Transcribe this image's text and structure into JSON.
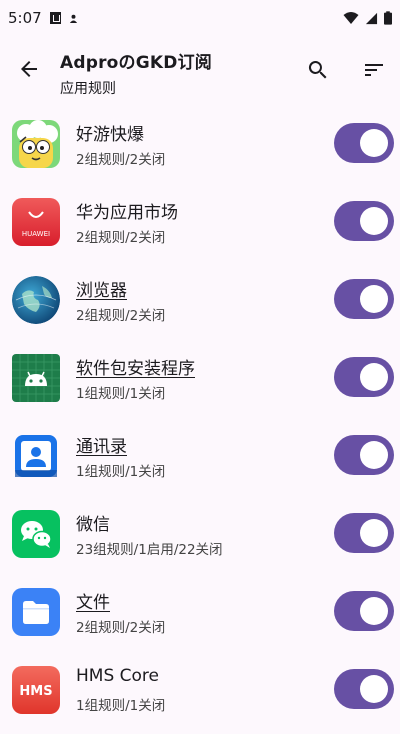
{
  "status_bar": {
    "time": "5:07"
  },
  "header": {
    "title": "AdproのGKD订阅",
    "subtitle": "应用规则"
  },
  "icons": {
    "back": "arrow-back-icon",
    "search": "search-icon",
    "sort": "sort-icon"
  },
  "apps": [
    {
      "name": "好游快爆",
      "summary": "2组规则/2关闭",
      "enabled": true,
      "underlined": false
    },
    {
      "name": "华为应用市场",
      "summary": "2组规则/2关闭",
      "enabled": true,
      "underlined": false,
      "icon_text": "HUAWEI"
    },
    {
      "name": "浏览器",
      "summary": "2组规则/2关闭",
      "enabled": true,
      "underlined": true
    },
    {
      "name": "软件包安装程序",
      "summary": "1组规则/1关闭",
      "enabled": true,
      "underlined": true
    },
    {
      "name": "通讯录",
      "summary": "1组规则/1关闭",
      "enabled": true,
      "underlined": true
    },
    {
      "name": "微信",
      "summary": "23组规则/1启用/22关闭",
      "enabled": true,
      "underlined": false
    },
    {
      "name": "文件",
      "summary": "2组规则/2关闭",
      "enabled": true,
      "underlined": true
    },
    {
      "name": "HMS Core",
      "summary": "1组规则/1关闭",
      "enabled": true,
      "underlined": false,
      "icon_text": "HMS"
    }
  ],
  "colors": {
    "accent": "#6750a4",
    "background": "#fdf8fd"
  }
}
